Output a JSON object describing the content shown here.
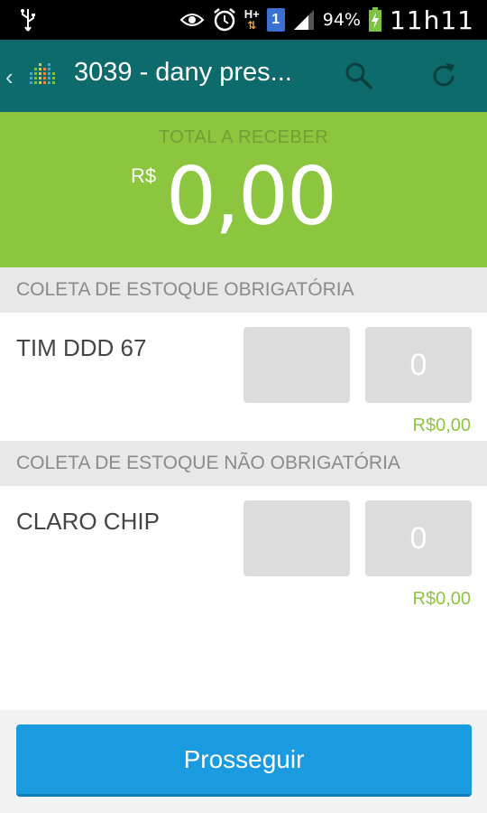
{
  "status_bar": {
    "battery_percent": "94%",
    "time": "11h11",
    "sim_label": "1",
    "network_label": "H+",
    "icons": [
      "usb-icon",
      "eye-icon",
      "alarm-icon",
      "network-h-plus-icon",
      "sim-icon",
      "signal-icon",
      "battery-icon"
    ]
  },
  "app_bar": {
    "title": "3039 - dany pres...",
    "back_glyph": "‹",
    "icons": [
      "back-icon",
      "app-logo-icon",
      "search-icon",
      "refresh-icon"
    ]
  },
  "total": {
    "label": "TOTAL A RECEBER",
    "currency": "R$",
    "amount": "0,00"
  },
  "sections": [
    {
      "header": "COLETA DE ESTOQUE OBRIGATÓRIA",
      "items": [
        {
          "name": "TIM DDD 67",
          "field_value": "",
          "quantity": "0",
          "price": "R$0,00"
        }
      ]
    },
    {
      "header": "COLETA DE ESTOQUE NÃO OBRIGATÓRIA",
      "items": [
        {
          "name": "CLARO CHIP",
          "field_value": "",
          "quantity": "0",
          "price": "R$0,00"
        }
      ]
    }
  ],
  "footer": {
    "button_label": "Prosseguir"
  },
  "colors": {
    "status_bar": "#000000",
    "app_bar": "#0d6b6b",
    "total_bg": "#8cc63f",
    "price_text": "#8cc63f",
    "button": "#1a9be0"
  }
}
